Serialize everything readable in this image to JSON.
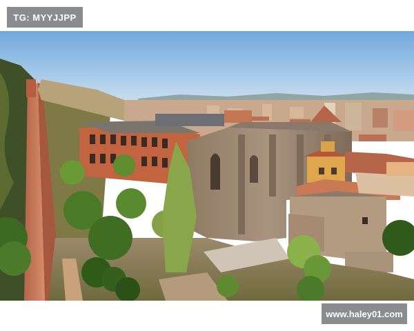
{
  "watermark_top": "TG: MYYJJPP",
  "watermark_bottom": "www.haley01.com",
  "colors": {
    "tag_background": "#8a8c8f",
    "tag_text": "#ffffff",
    "sky": "#8fc0e6",
    "stone": "#a08b73",
    "terracotta": "#c77a54"
  }
}
